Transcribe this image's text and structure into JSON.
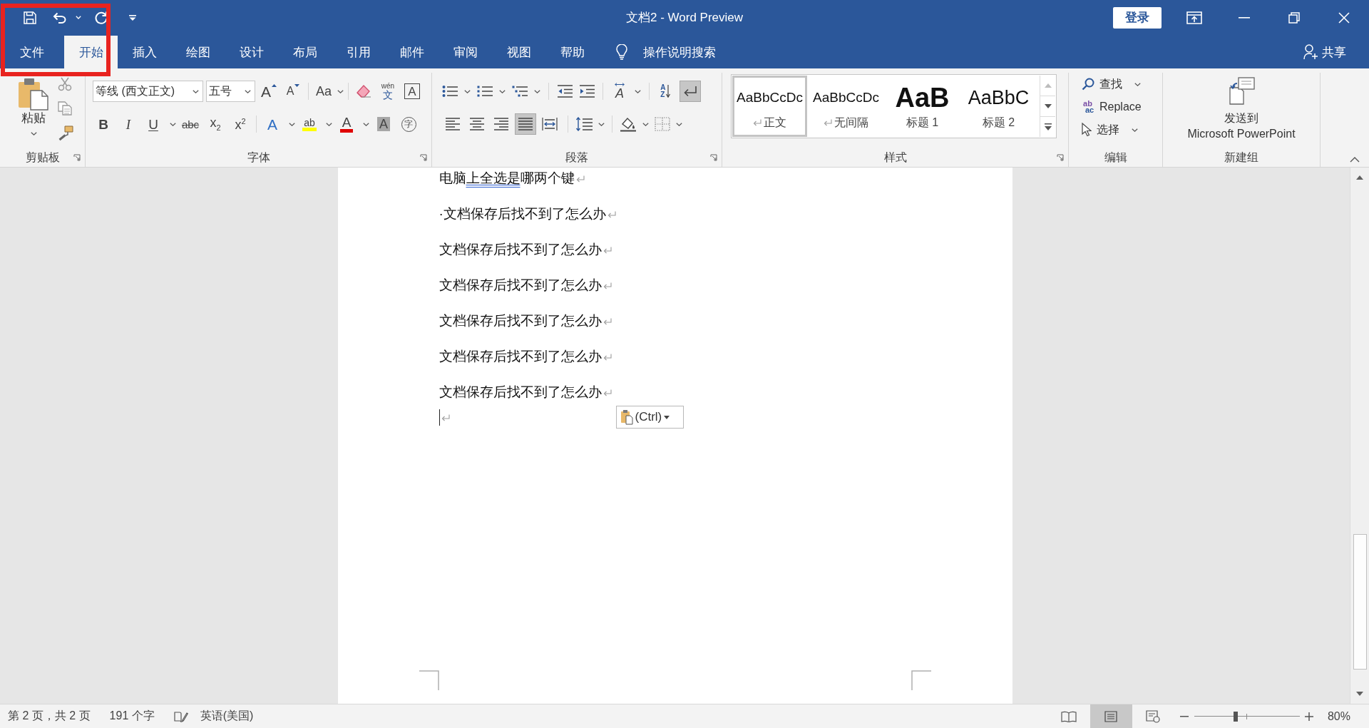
{
  "annotation": {
    "kind": "frame"
  },
  "window": {
    "title": "文档2 - Word Preview",
    "sign_in": "登录"
  },
  "tabs": [
    {
      "label": "文件",
      "selected": false
    },
    {
      "label": "开始",
      "selected": true
    },
    {
      "label": "插入",
      "selected": false
    },
    {
      "label": "绘图",
      "selected": false
    },
    {
      "label": "设计",
      "selected": false
    },
    {
      "label": "布局",
      "selected": false
    },
    {
      "label": "引用",
      "selected": false
    },
    {
      "label": "邮件",
      "selected": false
    },
    {
      "label": "审阅",
      "selected": false
    },
    {
      "label": "视图",
      "selected": false
    },
    {
      "label": "帮助",
      "selected": false
    }
  ],
  "tell_me": {
    "label": "操作说明搜索"
  },
  "share": {
    "label": "共享"
  },
  "ribbon": {
    "clipboard": {
      "label": "剪贴板",
      "paste": "粘贴"
    },
    "font": {
      "label": "字体",
      "font_name": "等线 (西文正文)",
      "font_size": "五号",
      "row1": [
        {
          "kind": "grow",
          "glyph": "A"
        },
        {
          "kind": "shrink",
          "glyph": "A"
        },
        {
          "kind": "case",
          "glyph": "Aa",
          "dropdown": true
        },
        {
          "kind": "clear"
        },
        {
          "kind": "phonetic",
          "glyph": "wén",
          "base": "文"
        },
        {
          "kind": "border",
          "glyph": "A"
        }
      ],
      "row2": [
        {
          "kind": "bold",
          "glyph": "B"
        },
        {
          "kind": "italic",
          "glyph": "I"
        },
        {
          "kind": "underline",
          "glyph": "U",
          "dropdown": true
        },
        {
          "kind": "strike",
          "glyph": "abc"
        },
        {
          "kind": "subscript",
          "glyph": "x$_{2}$"
        },
        {
          "kind": "superscript",
          "glyph": "x$^{2}$"
        },
        {
          "kind": "effects",
          "glyph": "A",
          "dropdown": true
        },
        {
          "kind": "highlight",
          "glyph": "ab",
          "dropdown": true
        },
        {
          "kind": "color",
          "glyph": "A",
          "dropdown": true
        },
        {
          "kind": "shading",
          "glyph": "A"
        },
        {
          "kind": "enclose",
          "glyph": "字"
        }
      ]
    },
    "paragraph": {
      "label": "段落",
      "row1": [
        {
          "kind": "bullets",
          "dropdown": true
        },
        {
          "kind": "numbering",
          "dropdown": true
        },
        {
          "kind": "multilevel",
          "dropdown": true
        },
        {
          "kind": "outdent"
        },
        {
          "kind": "indent"
        },
        {
          "kind": "asian_layout",
          "glyph": "A",
          "dropdown": true
        },
        {
          "kind": "sort",
          "glyph": "AZ"
        },
        {
          "kind": "show_marks",
          "on": true
        }
      ],
      "alignment": [
        {
          "kind": "left",
          "selected": false
        },
        {
          "kind": "center",
          "selected": false
        },
        {
          "kind": "right",
          "selected": false
        },
        {
          "kind": "justify",
          "selected": true
        },
        {
          "kind": "distributed",
          "selected": false
        }
      ],
      "row2": [
        {
          "kind": "line_spacing",
          "dropdown": true
        },
        {
          "kind": "shading",
          "dropdown": true
        },
        {
          "kind": "borders",
          "dropdown": true
        }
      ]
    },
    "styles": {
      "label": "样式",
      "items": [
        {
          "kind": "body",
          "preview": "AaBbCcDc",
          "name": "正文",
          "selected": true
        },
        {
          "kind": "body",
          "preview": "AaBbCcDc",
          "name": "无间隔",
          "selected": false
        },
        {
          "kind": "heading1",
          "preview": "AaB",
          "name": "标题 1",
          "selected": false
        },
        {
          "kind": "heading2",
          "preview": "AaBbC",
          "name": "标题 2",
          "selected": false
        }
      ]
    },
    "editing": {
      "label": "编辑",
      "items": [
        {
          "kind": "find",
          "label": "查找",
          "dropdown": true
        },
        {
          "kind": "replace",
          "label": "Replace",
          "icon_text": [
            "ab",
            "ac"
          ]
        },
        {
          "kind": "select",
          "label": "选择",
          "dropdown": true
        }
      ]
    },
    "new_group": {
      "label": "新建组",
      "button": "发送到\nMicrosoft PowerPoint"
    }
  },
  "document": {
    "paragraphs": [
      {
        "kind": "text",
        "segments": [
          {
            "text": "电脑",
            "flagged": false
          },
          {
            "text": "上全选是",
            "flagged": true
          },
          {
            "text": "哪两个键",
            "flagged": false
          }
        ]
      },
      {
        "kind": "text",
        "segments": [
          {
            "text": "·文档保存后找不到了怎么办",
            "flagged": false
          }
        ]
      },
      {
        "kind": "text",
        "segments": [
          {
            "text": "文档保存后找不到了怎么办",
            "flagged": false
          }
        ]
      },
      {
        "kind": "text",
        "segments": [
          {
            "text": "文档保存后找不到了怎么办",
            "flagged": false
          }
        ]
      },
      {
        "kind": "text",
        "segments": [
          {
            "text": "文档保存后找不到了怎么办",
            "flagged": false
          }
        ]
      },
      {
        "kind": "text",
        "segments": [
          {
            "text": "文档保存后找不到了怎么办",
            "flagged": false
          }
        ]
      },
      {
        "kind": "text",
        "segments": [
          {
            "text": "文档保存后找不到了怎么办",
            "flagged": false
          }
        ]
      },
      {
        "kind": "empty",
        "caret": true
      }
    ],
    "paste_options": {
      "label": "(Ctrl)"
    }
  },
  "status_bar": {
    "page": "第 2 页，共 2 页",
    "words": "191 个字",
    "language": "英语(美国)",
    "views": [
      {
        "kind": "read",
        "selected": false
      },
      {
        "kind": "print",
        "selected": true
      },
      {
        "kind": "web",
        "selected": false
      }
    ],
    "zoom": {
      "level": 0.39,
      "reading": "80%"
    }
  }
}
